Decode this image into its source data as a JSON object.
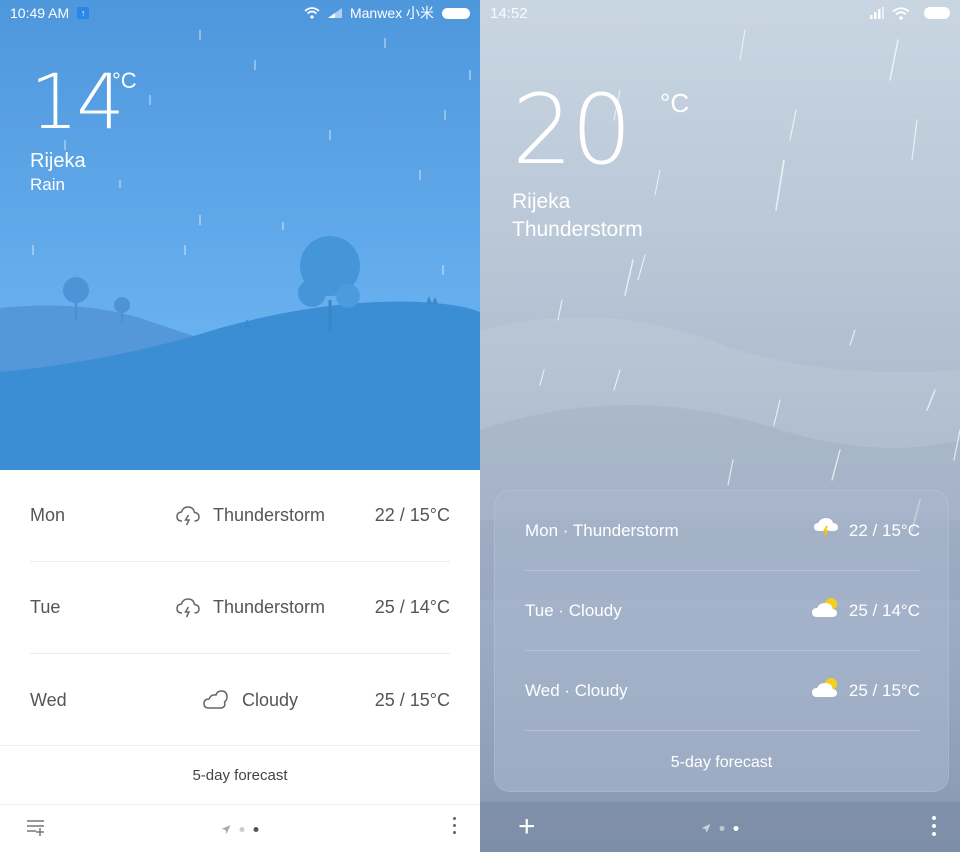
{
  "left_screen": {
    "status_bar": {
      "time": "10:49 AM",
      "carrier": "Manwex 小米",
      "icons": [
        "notification-icon",
        "wifi-icon",
        "signal-icon",
        "battery-icon"
      ]
    },
    "current": {
      "temperature": "14",
      "unit": "°C",
      "city": "Rijeka",
      "condition": "Rain"
    },
    "forecast": [
      {
        "day": "Mon",
        "icon": "thunderstorm-icon",
        "condition": "Thunderstorm",
        "temps": "22 / 15°C"
      },
      {
        "day": "Tue",
        "icon": "thunderstorm-icon",
        "condition": "Thunderstorm",
        "temps": "25 / 14°C"
      },
      {
        "day": "Wed",
        "icon": "cloudy-icon",
        "condition": "Cloudy",
        "temps": "25 / 15°C"
      }
    ],
    "forecast_button": "5-day forecast",
    "bottom_bar": {
      "left_icon": "manage-cities-icon",
      "page_indicator": {
        "count": 3,
        "active": 2,
        "first_is_location": true
      },
      "right_icon": "more-icon"
    },
    "colors": {
      "sky": "#5ea7e8",
      "hill": "#3d8fd4",
      "text": "#555555"
    }
  },
  "right_screen": {
    "status_bar": {
      "time": "14:52",
      "icons": [
        "signal-icon",
        "wifi-icon",
        "battery-icon"
      ]
    },
    "current": {
      "temperature": "20",
      "unit": "°C",
      "city": "Rijeka",
      "condition": "Thunderstorm"
    },
    "forecast": [
      {
        "label": "Mon · Thunderstorm",
        "icon": "thunderstorm-icon",
        "temps": "22 / 15°C"
      },
      {
        "label": "Tue · Cloudy",
        "icon": "partly-cloudy-icon",
        "temps": "25 / 14°C"
      },
      {
        "label": "Wed · Cloudy",
        "icon": "partly-cloudy-icon",
        "temps": "25 / 15°C"
      }
    ],
    "forecast_button": "5-day forecast",
    "bottom_bar": {
      "left_icon": "add-city-icon",
      "left_label": "+",
      "page_indicator": {
        "count": 3,
        "active": 2,
        "first_is_location": true
      },
      "right_icon": "more-icon"
    },
    "colors": {
      "sun": "#f5cf1a",
      "bolt": "#f2c811"
    }
  }
}
